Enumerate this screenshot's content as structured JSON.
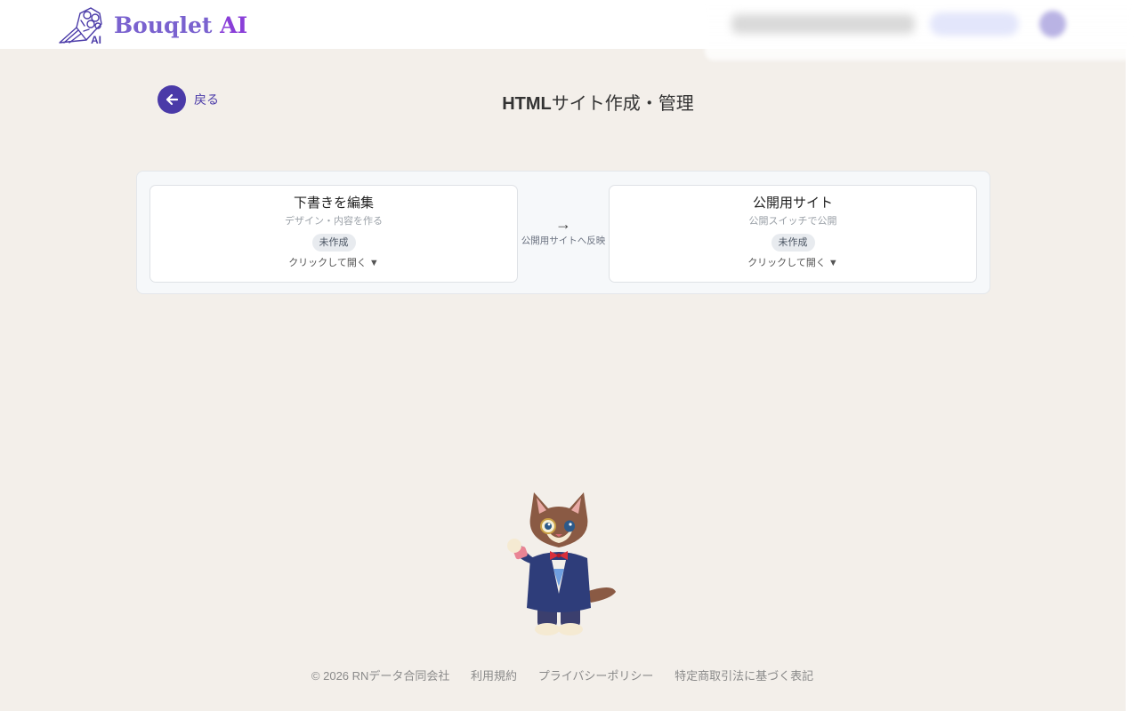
{
  "header": {
    "logo_icon": "bouquet-ai-logo-icon",
    "brand_text": "Bouqlet ",
    "brand_ai": "AI"
  },
  "nav": {
    "back_label": "戻る",
    "back_icon": "arrow-left-icon"
  },
  "page": {
    "title_bold": "HTML",
    "title_rest": "サイト作成・管理"
  },
  "flow": {
    "draft": {
      "title": "下書きを編集",
      "subtitle": "デザイン・内容を作る",
      "status": "未作成",
      "toggle": "クリックして開く ▼"
    },
    "arrow": "→",
    "arrow_caption": "公開用サイトへ反映",
    "public": {
      "title": "公開用サイト",
      "subtitle": "公開スイッチで公開",
      "status": "未作成",
      "toggle": "クリックして開く ▼"
    }
  },
  "mascot": {
    "icon": "cat-butler-mascot"
  },
  "footer": {
    "copyright": "© 2026 RNデータ合同会社",
    "terms": "利用規約",
    "privacy": "プライバシーポリシー",
    "commerce": "特定商取引法に基づく表記"
  },
  "colors": {
    "accent": "#4a3aa8",
    "brand": "#7a62cf",
    "background": "#f3efea"
  }
}
